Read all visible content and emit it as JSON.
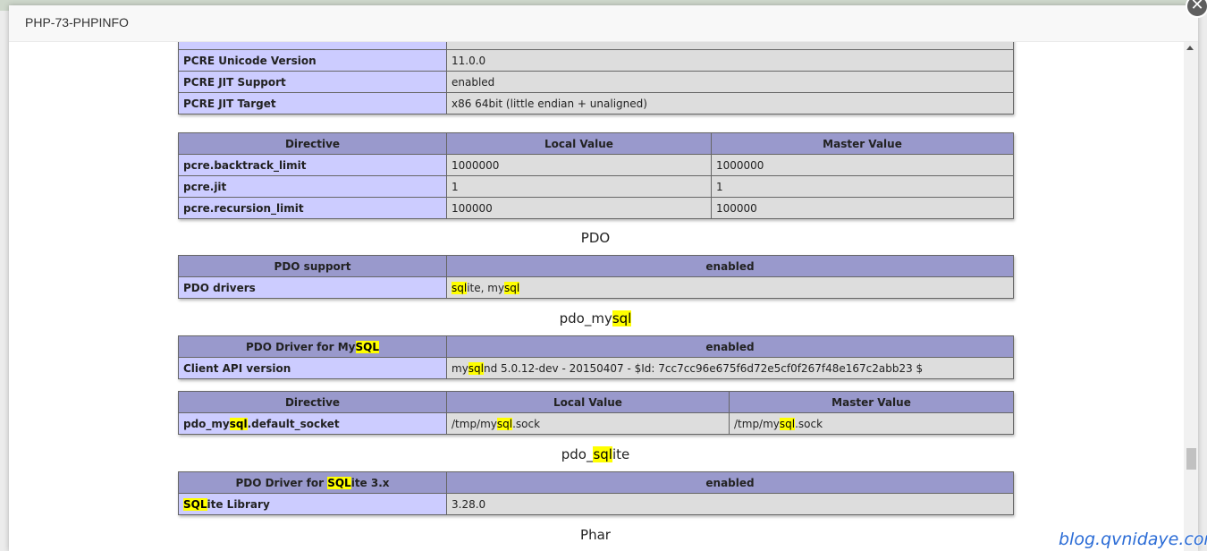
{
  "modal": {
    "title": "PHP-73-PHPINFO",
    "close_glyph": "✕"
  },
  "pcre": {
    "rows": [
      {
        "key": "PCRE Unicode Version",
        "value": "11.0.0"
      },
      {
        "key": "PCRE JIT Support",
        "value": "enabled"
      },
      {
        "key": "PCRE JIT Target",
        "value": "x86 64bit (little endian + unaligned)"
      }
    ],
    "directives": {
      "headers": [
        "Directive",
        "Local Value",
        "Master Value"
      ],
      "rows": [
        [
          "pcre.backtrack_limit",
          "1000000",
          "1000000"
        ],
        [
          "pcre.jit",
          "1",
          "1"
        ],
        [
          "pcre.recursion_limit",
          "100000",
          "100000"
        ]
      ]
    }
  },
  "pdo": {
    "title": "PDO",
    "header": [
      "PDO support",
      "enabled"
    ],
    "drivers": {
      "key": "PDO drivers",
      "value_a": "sql",
      "value_b": "ite, my",
      "value_c": "sql"
    }
  },
  "pdo_mysql": {
    "title_a": "pdo_my",
    "title_b": "sql",
    "header_key_a": "PDO Driver for My",
    "header_key_b": "SQL",
    "header_value": "enabled",
    "client": {
      "key": "Client API version",
      "value_a": "my",
      "value_b": "sql",
      "value_c": "nd 5.0.12-dev - 20150407 - $Id: 7cc7cc96e675f6d72e5cf0f267f48e167c2abb23 $"
    },
    "directives": {
      "headers": [
        "Directive",
        "Local Value",
        "Master Value"
      ],
      "key_a": "pdo_my",
      "key_b": "sql",
      "key_c": ".default_socket",
      "local_a": "/tmp/my",
      "local_b": "sql",
      "local_c": ".sock",
      "master_a": "/tmp/my",
      "master_b": "sql",
      "master_c": ".sock"
    }
  },
  "pdo_sqlite": {
    "title_a": "pdo_",
    "title_b": "sql",
    "title_c": "ite",
    "header_key_a": "PDO Driver for ",
    "header_key_b": "SQL",
    "header_key_c": "ite 3.x",
    "header_value": "enabled",
    "library": {
      "key_a": "SQL",
      "key_b": "ite Library",
      "value": "3.28.0"
    }
  },
  "phar": {
    "title": "Phar"
  },
  "watermark": "blog.qvnidaye.com",
  "colors": {
    "header_bg": "#9999cc",
    "key_bg": "#ccccff",
    "value_bg": "#dddddd",
    "highlight": "#ffff00"
  }
}
